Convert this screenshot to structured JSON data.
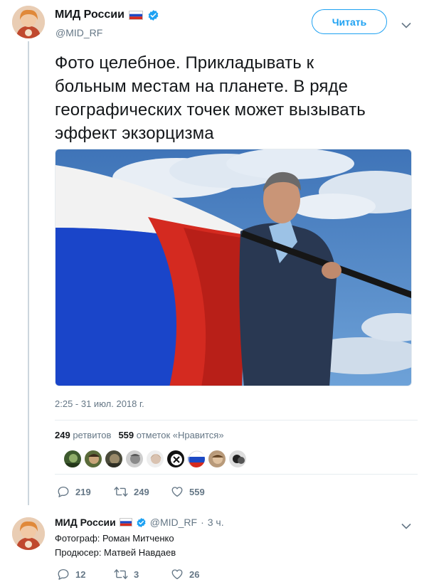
{
  "tweet": {
    "author_name": "МИД России",
    "author_handle": "@MID_RF",
    "follow_label": "Читать",
    "text_lines": [
      "Фото целебное. Прикладывать к",
      "больным местам на планете. В ряде",
      "географических точек может вызывать",
      "эффект экзорцизма"
    ],
    "timestamp": "2:25 - 31 июл. 2018 г.",
    "retweets_count": "249",
    "retweets_label": "ретвитов",
    "likes_count": "559",
    "likes_label": "отметок «Нравится»",
    "actions": {
      "replies": "219",
      "retweets": "249",
      "likes": "559"
    }
  },
  "reply": {
    "author_name": "МИД России",
    "author_handle": "@MID_RF",
    "separator": "·",
    "time": "3 ч.",
    "lines": [
      "Фотограф: Роман Митченко",
      "Продюсер: Матвей Навдаев"
    ],
    "actions": {
      "replies": "12",
      "retweets": "3",
      "likes": "26"
    }
  },
  "icons": {
    "verified": "verified-badge-icon",
    "flag": "russian-flag-icon",
    "reply": "reply-icon",
    "retweet": "retweet-icon",
    "like": "heart-icon",
    "caret": "chevron-down-icon"
  },
  "colors": {
    "accent": "#1da1f2",
    "secondary_text": "#657786",
    "primary_text": "#14171a",
    "divider": "#e6ecf0"
  }
}
